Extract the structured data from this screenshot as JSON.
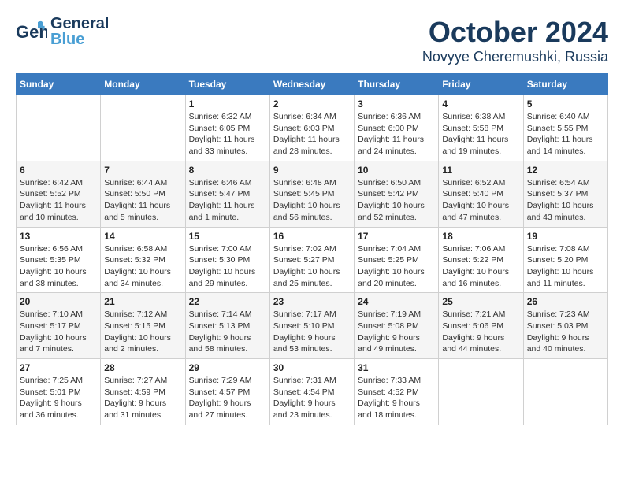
{
  "header": {
    "logo_general": "General",
    "logo_blue": "Blue",
    "month": "October 2024",
    "location": "Novyye Cheremushki, Russia"
  },
  "weekdays": [
    "Sunday",
    "Monday",
    "Tuesday",
    "Wednesday",
    "Thursday",
    "Friday",
    "Saturday"
  ],
  "weeks": [
    [
      {
        "day": "",
        "sunrise": "",
        "sunset": "",
        "daylight": ""
      },
      {
        "day": "",
        "sunrise": "",
        "sunset": "",
        "daylight": ""
      },
      {
        "day": "1",
        "sunrise": "Sunrise: 6:32 AM",
        "sunset": "Sunset: 6:05 PM",
        "daylight": "Daylight: 11 hours and 33 minutes."
      },
      {
        "day": "2",
        "sunrise": "Sunrise: 6:34 AM",
        "sunset": "Sunset: 6:03 PM",
        "daylight": "Daylight: 11 hours and 28 minutes."
      },
      {
        "day": "3",
        "sunrise": "Sunrise: 6:36 AM",
        "sunset": "Sunset: 6:00 PM",
        "daylight": "Daylight: 11 hours and 24 minutes."
      },
      {
        "day": "4",
        "sunrise": "Sunrise: 6:38 AM",
        "sunset": "Sunset: 5:58 PM",
        "daylight": "Daylight: 11 hours and 19 minutes."
      },
      {
        "day": "5",
        "sunrise": "Sunrise: 6:40 AM",
        "sunset": "Sunset: 5:55 PM",
        "daylight": "Daylight: 11 hours and 14 minutes."
      }
    ],
    [
      {
        "day": "6",
        "sunrise": "Sunrise: 6:42 AM",
        "sunset": "Sunset: 5:52 PM",
        "daylight": "Daylight: 11 hours and 10 minutes."
      },
      {
        "day": "7",
        "sunrise": "Sunrise: 6:44 AM",
        "sunset": "Sunset: 5:50 PM",
        "daylight": "Daylight: 11 hours and 5 minutes."
      },
      {
        "day": "8",
        "sunrise": "Sunrise: 6:46 AM",
        "sunset": "Sunset: 5:47 PM",
        "daylight": "Daylight: 11 hours and 1 minute."
      },
      {
        "day": "9",
        "sunrise": "Sunrise: 6:48 AM",
        "sunset": "Sunset: 5:45 PM",
        "daylight": "Daylight: 10 hours and 56 minutes."
      },
      {
        "day": "10",
        "sunrise": "Sunrise: 6:50 AM",
        "sunset": "Sunset: 5:42 PM",
        "daylight": "Daylight: 10 hours and 52 minutes."
      },
      {
        "day": "11",
        "sunrise": "Sunrise: 6:52 AM",
        "sunset": "Sunset: 5:40 PM",
        "daylight": "Daylight: 10 hours and 47 minutes."
      },
      {
        "day": "12",
        "sunrise": "Sunrise: 6:54 AM",
        "sunset": "Sunset: 5:37 PM",
        "daylight": "Daylight: 10 hours and 43 minutes."
      }
    ],
    [
      {
        "day": "13",
        "sunrise": "Sunrise: 6:56 AM",
        "sunset": "Sunset: 5:35 PM",
        "daylight": "Daylight: 10 hours and 38 minutes."
      },
      {
        "day": "14",
        "sunrise": "Sunrise: 6:58 AM",
        "sunset": "Sunset: 5:32 PM",
        "daylight": "Daylight: 10 hours and 34 minutes."
      },
      {
        "day": "15",
        "sunrise": "Sunrise: 7:00 AM",
        "sunset": "Sunset: 5:30 PM",
        "daylight": "Daylight: 10 hours and 29 minutes."
      },
      {
        "day": "16",
        "sunrise": "Sunrise: 7:02 AM",
        "sunset": "Sunset: 5:27 PM",
        "daylight": "Daylight: 10 hours and 25 minutes."
      },
      {
        "day": "17",
        "sunrise": "Sunrise: 7:04 AM",
        "sunset": "Sunset: 5:25 PM",
        "daylight": "Daylight: 10 hours and 20 minutes."
      },
      {
        "day": "18",
        "sunrise": "Sunrise: 7:06 AM",
        "sunset": "Sunset: 5:22 PM",
        "daylight": "Daylight: 10 hours and 16 minutes."
      },
      {
        "day": "19",
        "sunrise": "Sunrise: 7:08 AM",
        "sunset": "Sunset: 5:20 PM",
        "daylight": "Daylight: 10 hours and 11 minutes."
      }
    ],
    [
      {
        "day": "20",
        "sunrise": "Sunrise: 7:10 AM",
        "sunset": "Sunset: 5:17 PM",
        "daylight": "Daylight: 10 hours and 7 minutes."
      },
      {
        "day": "21",
        "sunrise": "Sunrise: 7:12 AM",
        "sunset": "Sunset: 5:15 PM",
        "daylight": "Daylight: 10 hours and 2 minutes."
      },
      {
        "day": "22",
        "sunrise": "Sunrise: 7:14 AM",
        "sunset": "Sunset: 5:13 PM",
        "daylight": "Daylight: 9 hours and 58 minutes."
      },
      {
        "day": "23",
        "sunrise": "Sunrise: 7:17 AM",
        "sunset": "Sunset: 5:10 PM",
        "daylight": "Daylight: 9 hours and 53 minutes."
      },
      {
        "day": "24",
        "sunrise": "Sunrise: 7:19 AM",
        "sunset": "Sunset: 5:08 PM",
        "daylight": "Daylight: 9 hours and 49 minutes."
      },
      {
        "day": "25",
        "sunrise": "Sunrise: 7:21 AM",
        "sunset": "Sunset: 5:06 PM",
        "daylight": "Daylight: 9 hours and 44 minutes."
      },
      {
        "day": "26",
        "sunrise": "Sunrise: 7:23 AM",
        "sunset": "Sunset: 5:03 PM",
        "daylight": "Daylight: 9 hours and 40 minutes."
      }
    ],
    [
      {
        "day": "27",
        "sunrise": "Sunrise: 7:25 AM",
        "sunset": "Sunset: 5:01 PM",
        "daylight": "Daylight: 9 hours and 36 minutes."
      },
      {
        "day": "28",
        "sunrise": "Sunrise: 7:27 AM",
        "sunset": "Sunset: 4:59 PM",
        "daylight": "Daylight: 9 hours and 31 minutes."
      },
      {
        "day": "29",
        "sunrise": "Sunrise: 7:29 AM",
        "sunset": "Sunset: 4:57 PM",
        "daylight": "Daylight: 9 hours and 27 minutes."
      },
      {
        "day": "30",
        "sunrise": "Sunrise: 7:31 AM",
        "sunset": "Sunset: 4:54 PM",
        "daylight": "Daylight: 9 hours and 23 minutes."
      },
      {
        "day": "31",
        "sunrise": "Sunrise: 7:33 AM",
        "sunset": "Sunset: 4:52 PM",
        "daylight": "Daylight: 9 hours and 18 minutes."
      },
      {
        "day": "",
        "sunrise": "",
        "sunset": "",
        "daylight": ""
      },
      {
        "day": "",
        "sunrise": "",
        "sunset": "",
        "daylight": ""
      }
    ]
  ]
}
